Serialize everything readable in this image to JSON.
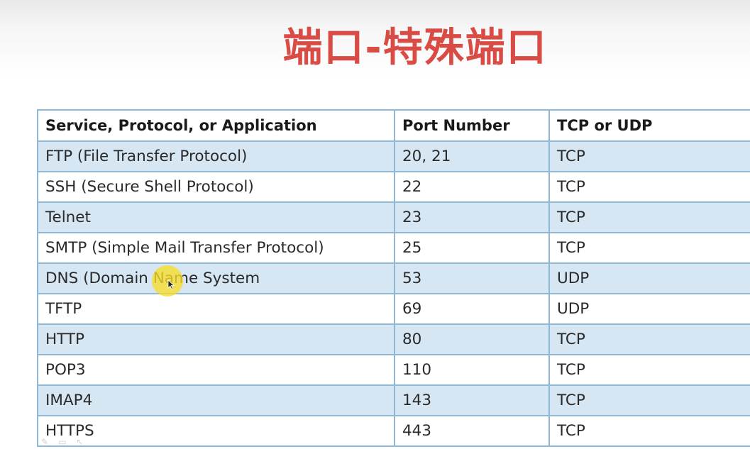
{
  "title": "端口-特殊端口",
  "table": {
    "headers": [
      "Service, Protocol, or Application",
      "Port Number",
      "TCP or UDP"
    ],
    "rows": [
      [
        "FTP (File Transfer Protocol)",
        "20, 21",
        "TCP"
      ],
      [
        "SSH (Secure Shell Protocol)",
        "22",
        "TCP"
      ],
      [
        "Telnet",
        "23",
        "TCP"
      ],
      [
        "SMTP (Simple Mail Transfer Protocol)",
        "25",
        "TCP"
      ],
      [
        "DNS (Domain Name System",
        "53",
        "UDP"
      ],
      [
        "TFTP",
        "69",
        "UDP"
      ],
      [
        "HTTP",
        "80",
        "TCP"
      ],
      [
        "POP3",
        "110",
        "TCP"
      ],
      [
        "IMAP4",
        "143",
        "TCP"
      ],
      [
        "HTTPS",
        "443",
        "TCP"
      ]
    ]
  },
  "icons": {
    "cursor": "mouse-pointer-icon",
    "pen": "pen-icon",
    "slides": "slides-icon",
    "pointer": "pointer-icon"
  },
  "colors": {
    "title": "#d94c46",
    "row_alt": "#d6e7f3",
    "border": "#8fb8d6",
    "cursor_highlight": "#f8dc28"
  }
}
